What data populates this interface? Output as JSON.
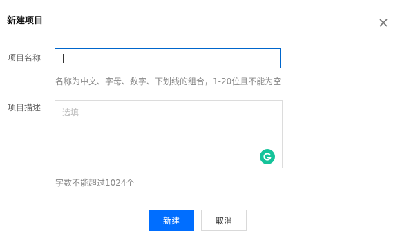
{
  "dialog": {
    "title": "新建项目",
    "close_icon": "close-icon"
  },
  "form": {
    "name_label": "项目名称",
    "name_value": "",
    "name_hint": "名称为中文、字母、数字、下划线的组合，1-20位且不能为空",
    "desc_label": "项目描述",
    "desc_placeholder": "选填",
    "desc_hint": "字数不能超过1024个",
    "grammarly_icon": "grammarly-icon"
  },
  "footer": {
    "create_label": "新建",
    "cancel_label": "取消"
  },
  "colors": {
    "primary": "#006eff",
    "input_focus_border": "#0066cc",
    "grammarly": "#15c39a"
  }
}
